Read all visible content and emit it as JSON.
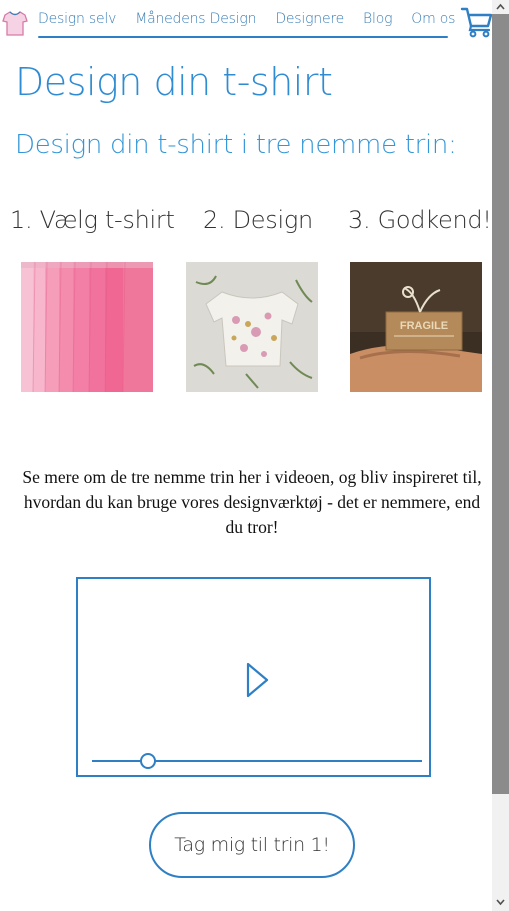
{
  "nav": {
    "items": [
      {
        "label": "Design selv"
      },
      {
        "label": "Månedens Design"
      },
      {
        "label": "Designere"
      },
      {
        "label": "Blog"
      },
      {
        "label": "Om os"
      }
    ],
    "logo_icon": "tshirt-icon",
    "cart_icon": "cart-icon"
  },
  "page": {
    "title": "Design din t-shirt",
    "subtitle": "Design din t-shirt i tre nemme trin:"
  },
  "steps": [
    {
      "label": "1. Vælg t-shirt",
      "image": "pink-tshirts-photo"
    },
    {
      "label": "2. Design",
      "image": "floral-tshirt-photo"
    },
    {
      "label": "3. Godkend!",
      "image": "fragile-package-photo"
    }
  ],
  "intro_text": "Se mere om de tre nemme trin her i videoen, og bliv inspireret til, hvordan du kan bruge vores designværktøj - det er nemmere, end du tror!",
  "video": {
    "progress": 0.17
  },
  "cta": {
    "label": "Tag mig til trin 1!"
  },
  "colors": {
    "accent": "#2f7fc4",
    "title": "#2f8cd3",
    "text": "#333333"
  }
}
